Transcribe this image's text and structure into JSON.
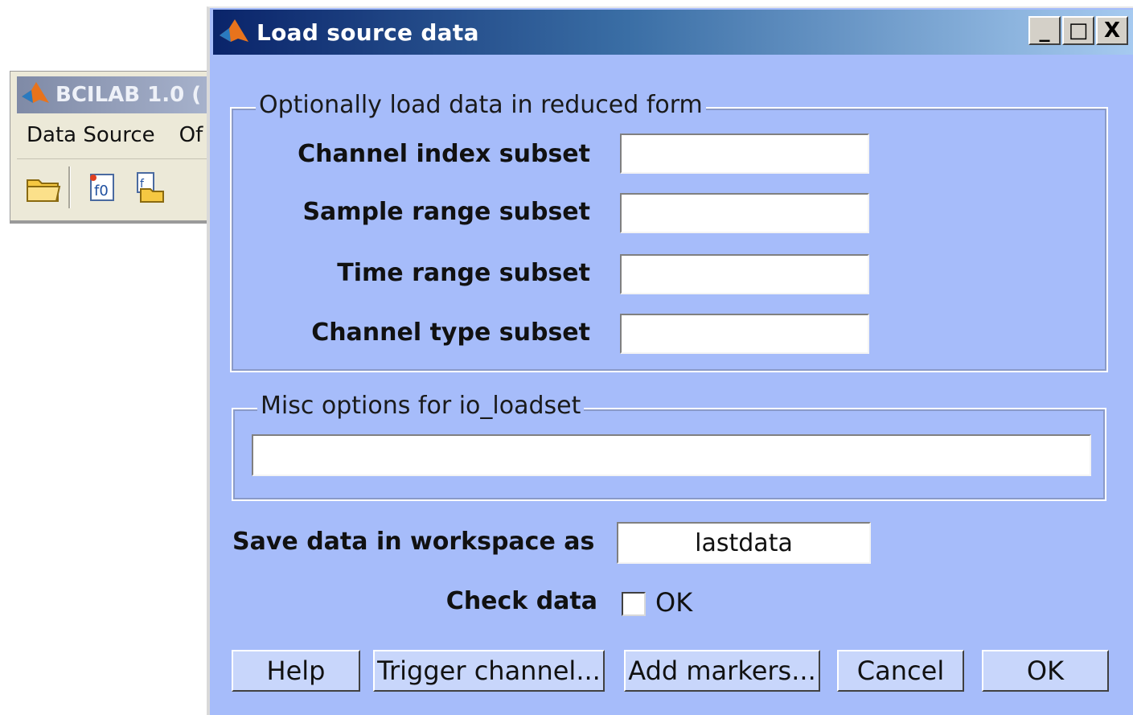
{
  "background_window": {
    "title": "BCILAB 1.0 (",
    "menu": [
      "Data Source",
      "Of"
    ]
  },
  "dialog": {
    "title": "Load source data",
    "window_buttons": {
      "minimize": "_",
      "maximize": "□",
      "close": "X"
    },
    "reduced_form": {
      "legend": "Optionally load data in reduced form",
      "fields": [
        {
          "label": "Channel index subset",
          "value": ""
        },
        {
          "label": "Sample range subset",
          "value": ""
        },
        {
          "label": "Time range subset",
          "value": ""
        },
        {
          "label": "Channel type subset",
          "value": ""
        }
      ]
    },
    "misc": {
      "legend": "Misc options for io_loadset",
      "value": ""
    },
    "save": {
      "label": "Save data in workspace as",
      "value": "lastdata"
    },
    "check": {
      "label": "Check data",
      "checkbox_label": "OK",
      "checked": false
    },
    "buttons": {
      "help": "Help",
      "trigger": "Trigger channel...",
      "markers": "Add markers...",
      "cancel": "Cancel",
      "ok": "OK"
    }
  }
}
